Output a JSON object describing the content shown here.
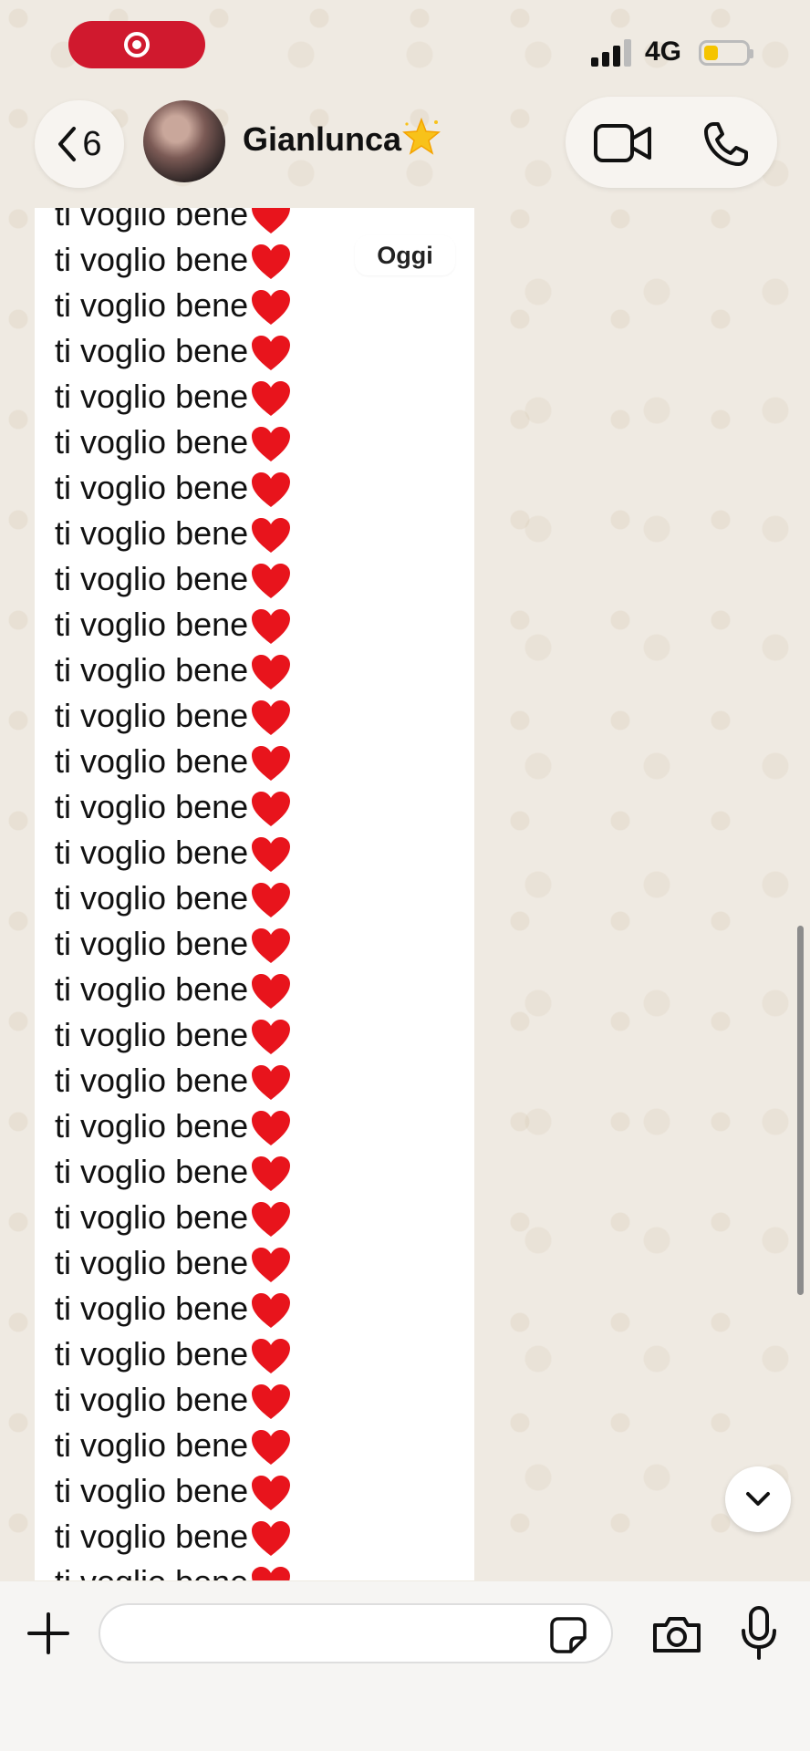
{
  "status_bar": {
    "network": "4G",
    "recording_icon": "record-icon",
    "battery_level": 0.35,
    "colors": {
      "recording": "#d0192e",
      "battery": "#f5c400"
    }
  },
  "header": {
    "back_count": "6",
    "contact_name": "Gianlunca",
    "contact_emoji": "glowing-star-icon",
    "icons": [
      "chevron-left-icon",
      "video-call-icon",
      "phone-icon"
    ]
  },
  "chat": {
    "date_chip": "Oggi",
    "message_lines": [
      "ti voglio bene",
      "ti voglio bene",
      "ti voglio bene",
      "ti voglio bene",
      "ti voglio bene",
      "ti voglio bene",
      "ti voglio bene",
      "ti voglio bene",
      "ti voglio bene",
      "ti voglio bene",
      "ti voglio bene",
      "ti voglio bene",
      "ti voglio bene",
      "ti voglio bene",
      "ti voglio bene",
      "ti voglio bene",
      "ti voglio bene",
      "ti voglio bene",
      "ti voglio bene",
      "ti voglio bene",
      "ti voglio bene",
      "ti voglio bene",
      "ti voglio bene",
      "ti voglio bene",
      "ti voglio bene",
      "ti voglio bene",
      "ti voglio bene",
      "ti voglio bene",
      "ti voglio bene",
      "ti voglio bene",
      "ti voglio bene",
      "ti voglio bene"
    ],
    "line_emoji": "red-heart-icon",
    "colors": {
      "heart": "#e8141c",
      "bubble": "#ffffff",
      "wallpaper": "#efeae2"
    }
  },
  "input_bar": {
    "placeholder": "",
    "icons": [
      "plus-icon",
      "sticker-icon",
      "camera-icon",
      "microphone-icon"
    ]
  }
}
